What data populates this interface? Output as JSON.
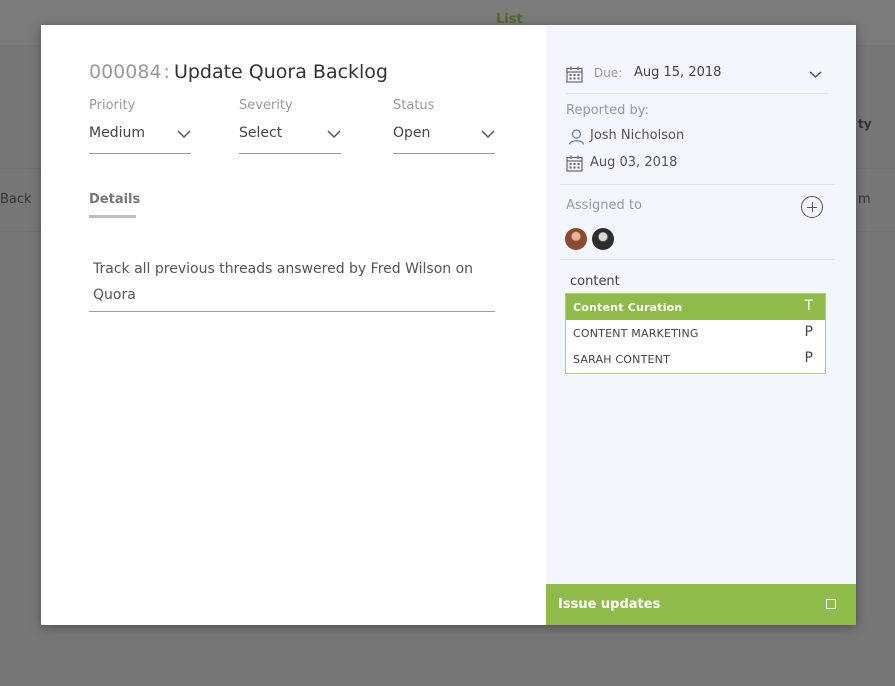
{
  "background": {
    "tab_label": "List",
    "row_left_text": "Back",
    "header_right_text": "ty",
    "row_right_text": "m"
  },
  "issue": {
    "id": "000084",
    "separator": ":",
    "title": "Update Quora Backlog"
  },
  "fields": {
    "priority": {
      "label": "Priority",
      "value": "Medium"
    },
    "severity": {
      "label": "Severity",
      "value": "Select"
    },
    "status": {
      "label": "Status",
      "value": "Open"
    }
  },
  "tabs": {
    "details": "Details"
  },
  "description": "Track all previous threads answered by Fred Wilson on Quora",
  "sidebar": {
    "due_label": "Due:",
    "due_value": "Aug 15, 2018",
    "reported_by_label": "Reported by:",
    "reporter_name": "Josh Nicholson",
    "reported_date": "Aug 03, 2018",
    "assigned_to_label": "Assigned to",
    "search_value": "content",
    "suggestions": [
      {
        "name": "Content Curation",
        "tag": "T"
      },
      {
        "name": "CONTENT MARKETING",
        "tag": "P"
      },
      {
        "name": "SARAH CONTENT",
        "tag": "P"
      }
    ],
    "updates_label": "Issue updates"
  },
  "colors": {
    "accent": "#8fbb4b",
    "sidebar_bg": "#f4f6fd",
    "overlay": "#777777"
  },
  "icons": {
    "calendar": "calendar-icon",
    "user": "user-icon",
    "add": "plus-circle-icon",
    "chevron": "chevron-down-icon"
  }
}
